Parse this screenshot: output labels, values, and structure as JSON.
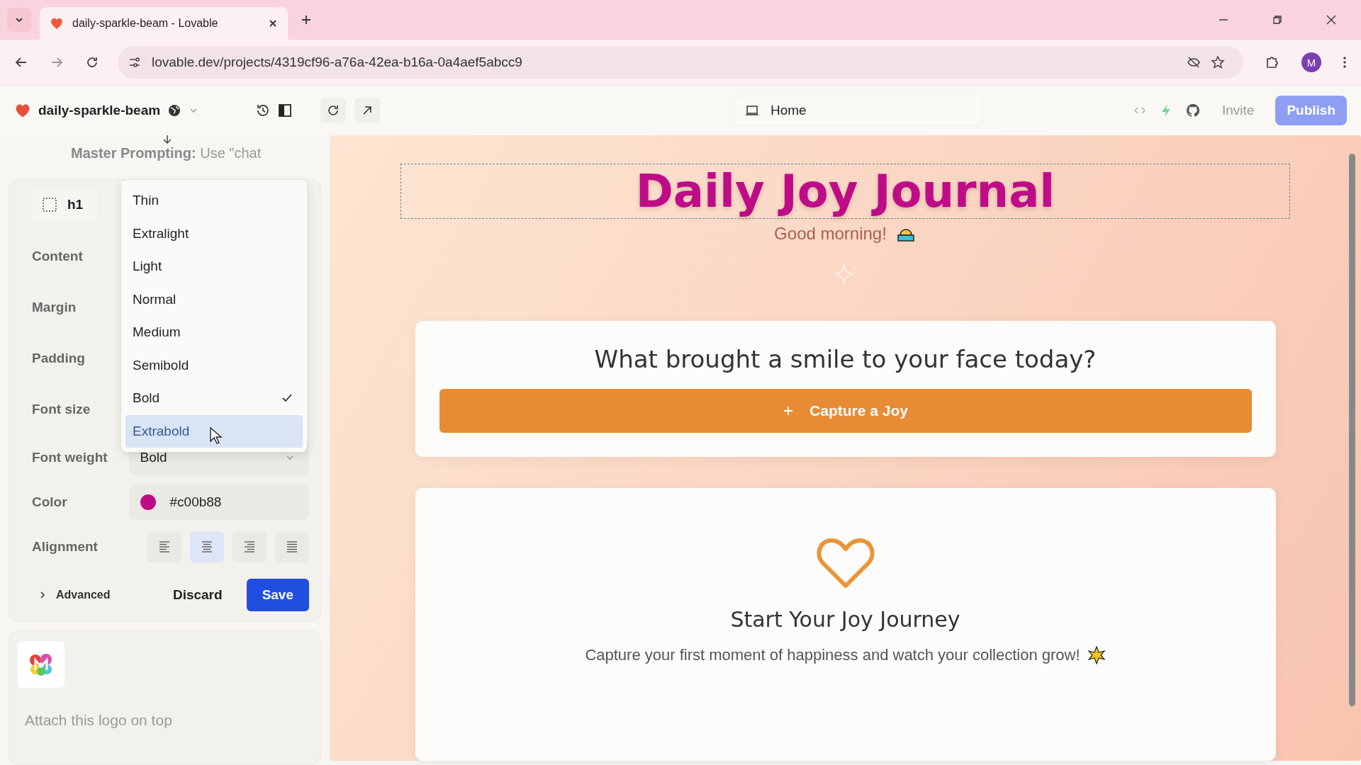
{
  "browser": {
    "tab_title": "daily-sparkle-beam - Lovable",
    "url": "lovable.dev/projects/4319cf96-a76a-42ea-b16a-0a4aef5abcc9",
    "profile_initial": "M"
  },
  "toolbar": {
    "project_name": "daily-sparkle-beam",
    "page": "Home",
    "invite": "Invite",
    "publish": "Publish"
  },
  "chat": {
    "prompt": "**Master Prompting:** Use \"chat"
  },
  "editor": {
    "element_tag": "h1",
    "fields": [
      {
        "label": "Content",
        "kind": "hidden"
      },
      {
        "label": "Margin",
        "kind": "hidden"
      },
      {
        "label": "Padding",
        "kind": "hidden"
      },
      {
        "label": "Font size",
        "kind": "hidden"
      },
      {
        "label": "Font weight",
        "kind": "select",
        "value": "Bold"
      },
      {
        "label": "Color",
        "kind": "color",
        "value": "#c00b88"
      },
      {
        "label": "Alignment",
        "kind": "align"
      }
    ],
    "alignment": [
      {
        "kind": "left",
        "selected": false
      },
      {
        "kind": "center",
        "selected": true
      },
      {
        "kind": "right",
        "selected": false
      },
      {
        "kind": "justify",
        "selected": false
      }
    ],
    "advanced": "Advanced",
    "discard": "Discard",
    "save": "Save"
  },
  "weight_menu": [
    {
      "label": "Thin",
      "checked": false,
      "selected": false
    },
    {
      "label": "Extralight",
      "checked": false,
      "selected": false
    },
    {
      "label": "Light",
      "checked": false,
      "selected": false
    },
    {
      "label": "Normal",
      "checked": false,
      "selected": false
    },
    {
      "label": "Medium",
      "checked": false,
      "selected": false
    },
    {
      "label": "Semibold",
      "checked": false,
      "selected": false
    },
    {
      "label": "Bold",
      "checked": true,
      "selected": false
    },
    {
      "label": "Extrabold",
      "checked": false,
      "selected": true
    }
  ],
  "attachment": {
    "caption": "Attach this logo on top"
  },
  "preview": {
    "title": "Daily Joy Journal",
    "greeting": "Good morning!",
    "question": "What brought a smile to your face today?",
    "capture_button": "Capture a Joy",
    "empty_title": "Start Your Joy Journey",
    "empty_text": "Capture your first moment of happiness and watch your collection grow!"
  }
}
